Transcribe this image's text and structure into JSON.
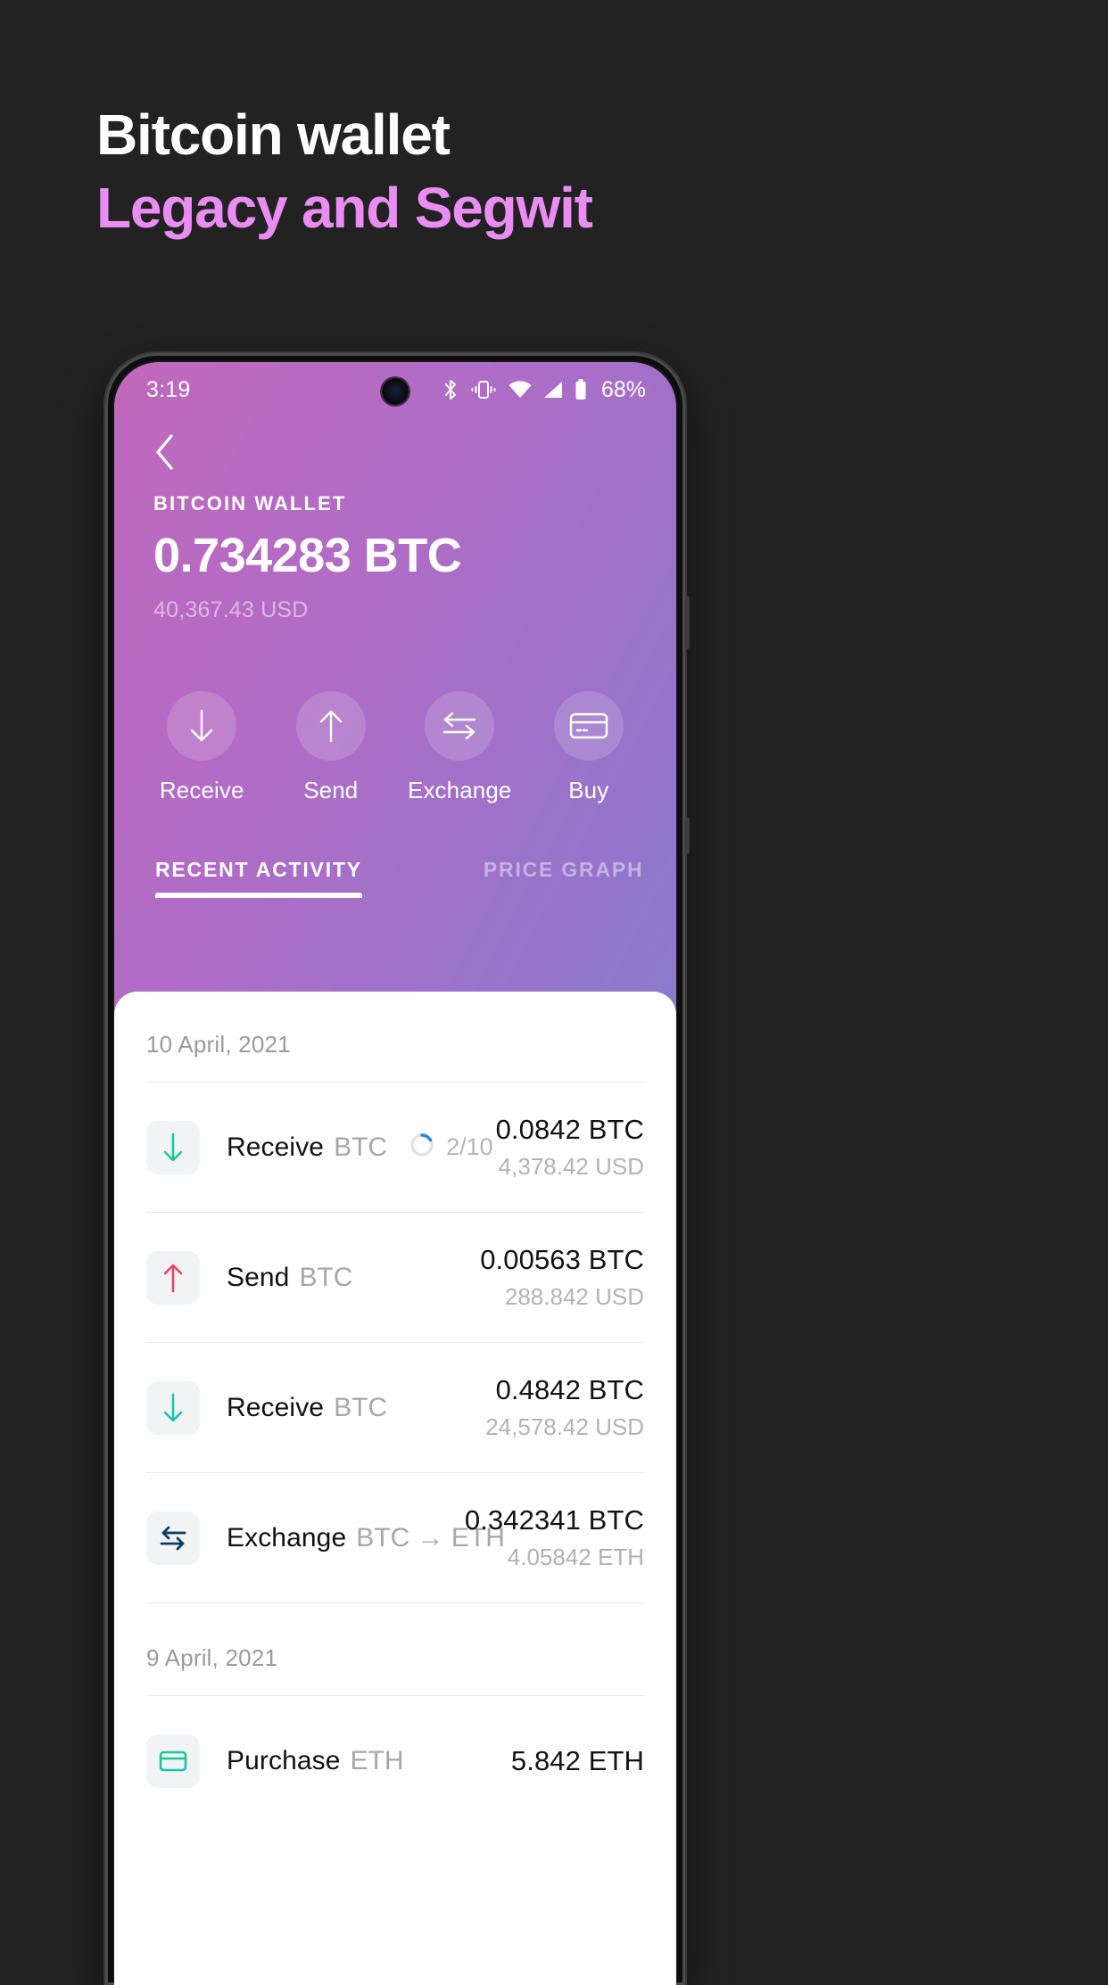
{
  "promo": {
    "line1": "Bitcoin wallet",
    "line2": "Legacy and Segwit",
    "accent_color": "#ea8df2",
    "background_color": "#222222"
  },
  "status_bar": {
    "time": "3:19",
    "battery": "68%",
    "icons": [
      "bluetooth-icon",
      "vibrate-icon",
      "wifi-icon",
      "cellular-signal-icon",
      "battery-icon"
    ]
  },
  "wallet": {
    "back_icon": "chevron-left-icon",
    "label": "BITCOIN WALLET",
    "balance": "0.734283 BTC",
    "balance_fiat": "40,367.43 USD"
  },
  "actions": [
    {
      "label": "Receive",
      "icon": "arrow-down-icon"
    },
    {
      "label": "Send",
      "icon": "arrow-up-icon"
    },
    {
      "label": "Exchange",
      "icon": "swap-arrows-icon"
    },
    {
      "label": "Buy",
      "icon": "credit-card-icon"
    }
  ],
  "tabs": [
    {
      "label": "RECENT ACTIVITY",
      "active": true
    },
    {
      "label": "PRICE GRAPH",
      "active": false
    }
  ],
  "activity": {
    "groups": [
      {
        "date": "10 April, 2021",
        "rows": [
          {
            "icon": "arrow-down-icon",
            "icon_color": "#19c79e",
            "title": "Receive",
            "subtitle": "BTC",
            "progress": "2/10",
            "progress_color": "#1e88e5",
            "progress_value": 2,
            "progress_max": 10,
            "amount": "0.0842 BTC",
            "amount_sub": "4,378.42 USD"
          },
          {
            "icon": "arrow-up-icon",
            "icon_color": "#ef4060",
            "title": "Send",
            "subtitle": "BTC",
            "progress": "",
            "progress_color": "",
            "progress_value": 0,
            "progress_max": 0,
            "amount": "0.00563 BTC",
            "amount_sub": "288.842 USD"
          },
          {
            "icon": "arrow-down-icon",
            "icon_color": "#19c79e",
            "title": "Receive",
            "subtitle": "BTC",
            "progress": "",
            "progress_color": "",
            "progress_value": 0,
            "progress_max": 0,
            "amount": "0.4842 BTC",
            "amount_sub": "24,578.42 USD"
          },
          {
            "icon": "swap-arrows-icon",
            "icon_color": "#0d3c61",
            "title": "Exchange",
            "subtitle": "BTC → ETH",
            "progress": "",
            "progress_color": "",
            "progress_value": 0,
            "progress_max": 0,
            "amount": "0.342341 BTC",
            "amount_sub": "4.05842 ETH"
          }
        ]
      },
      {
        "date": "9 April, 2021",
        "rows": [
          {
            "icon": "credit-card-icon",
            "icon_color": "#19c79e",
            "title": "Purchase",
            "subtitle": "ETH",
            "progress": "",
            "progress_color": "",
            "progress_value": 0,
            "progress_max": 0,
            "amount": "5.842 ETH",
            "amount_sub": ""
          }
        ]
      }
    ]
  }
}
